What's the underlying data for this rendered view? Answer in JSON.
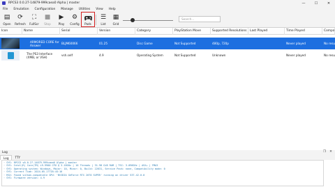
{
  "window": {
    "title": "RPCS3 0.0.27-14879-999caea0 Alpha | master",
    "minimize": "—",
    "maximize": "☐",
    "close": "✕"
  },
  "menu": [
    "File",
    "Emulation",
    "Configuration",
    "Manage",
    "Utilities",
    "View",
    "Help"
  ],
  "toolbar": {
    "buttons": [
      {
        "label": "Open",
        "icon": "folder-open-icon",
        "glyph": "▤"
      },
      {
        "label": "Refresh",
        "icon": "refresh-icon",
        "glyph": "⟳"
      },
      {
        "label": "FullScr",
        "icon": "fullscreen-icon",
        "glyph": "⛶"
      },
      {
        "label": "Stop",
        "icon": "stop-icon",
        "glyph": "■"
      },
      {
        "label": "Play",
        "icon": "play-icon",
        "glyph": "▶"
      },
      {
        "label": "Config",
        "icon": "gear-icon",
        "glyph": "⚙"
      },
      {
        "label": "Pads",
        "icon": "gamepad-icon",
        "glyph": "🎮"
      },
      {
        "label": "List",
        "icon": "list-view-icon",
        "glyph": "☰"
      },
      {
        "label": "Grid",
        "icon": "grid-view-icon",
        "glyph": "▦"
      }
    ],
    "icon_size_level": 0.17,
    "search_placeholder": "Search..."
  },
  "game_list": {
    "columns": [
      "Icon",
      "Name",
      "Serial",
      "Version",
      "Category",
      "PlayStation Move",
      "Supported Resolutions",
      "Last Played",
      "Time Played",
      "Compatibility"
    ],
    "rows": [
      {
        "icon": "armored-core-icon",
        "name": "ARMORED CORE for Answer",
        "serial": "BLJM60066",
        "version": "01.25",
        "category": "Disc Game",
        "move": "Not Supported",
        "resolutions": "480p, 720p",
        "last_played": "",
        "time_played": "Never played",
        "compatibility": "No results",
        "selected": true
      },
      {
        "icon": "ps3-vsh-icon",
        "name": "The PS3 Interface (XMB, or VSH)",
        "serial": "vsh.self",
        "version": "4.9",
        "category": "Operating System",
        "move": "Not Supported",
        "resolutions": "Unknown",
        "last_played": "",
        "time_played": "Never played",
        "compatibility": "No results",
        "selected": false
      }
    ]
  },
  "log": {
    "title": "Log",
    "tabs": [
      "Log",
      "TTY"
    ],
    "active_tab": "Log",
    "lines": [
      "· SYS: RPCS3 v0.0.27-14879-999caea0 Alpha | master",
      "· SYS: Intel(R) Core(TM) i9-9900 CPU @ 3.10GHz | 16 Threads | 31.98 GiB RAM | TSC: 3.096GHz | AVX+ | FMA3",
      "· SYS: Operating system: Windows, Major: 10, Minor: 0, Build: 22631, Service Pack: none, Compatibility mode: 0",
      "· SYS: Current Time: 2024-05-17T18:44:16",
      "· RSX: Found vulkan-compatible GPU: 'NVIDIA GeForce RTX 2070 SUPER' running on driver 537.42.0.0",
      "· SYS: Firmware version: 4.9"
    ]
  }
}
